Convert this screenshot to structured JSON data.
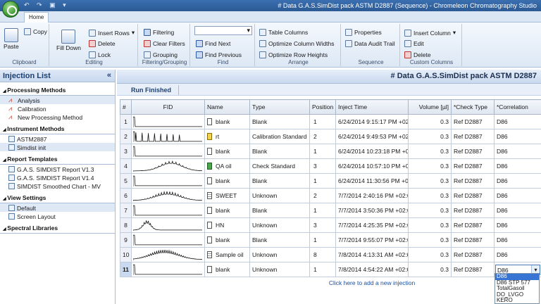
{
  "window": {
    "title": "# Data G.A.S.SimDist pack ASTM D2887 (Sequence) - Chromeleon Chromatography Studio"
  },
  "ribbon": {
    "tab": "Home",
    "clipboard": {
      "label": "Clipboard",
      "paste": "Paste",
      "copy": "Copy"
    },
    "editing": {
      "label": "Editing",
      "fill_down": "Fill Down",
      "insert_rows": "Insert Rows",
      "delete": "Delete",
      "lock": "Lock"
    },
    "filtering": {
      "label": "Filtering/Grouping",
      "filtering": "Filtering",
      "clear_filters": "Clear Filters",
      "grouping": "Grouping"
    },
    "find": {
      "label": "Find",
      "find_next": "Find Next",
      "find_previous": "Find Previous"
    },
    "arrange": {
      "label": "Arrange",
      "table_columns": "Table Columns",
      "optimize_widths": "Optimize Column Widths",
      "optimize_heights": "Optimize Row Heights"
    },
    "sequence": {
      "label": "Sequence",
      "properties": "Properties",
      "audit_trail": "Data Audit Trail"
    },
    "custom": {
      "label": "Custom Columns",
      "insert_column": "Insert Column",
      "edit": "Edit",
      "delete": "Delete"
    }
  },
  "sidebar": {
    "title": "Injection List",
    "collapse": "«",
    "sections": [
      {
        "title": "Processing Methods",
        "items": [
          "Analysis",
          "Calibration",
          "New Processing Method"
        ]
      },
      {
        "title": "Instrument Methods",
        "items": [
          "ASTM2887",
          "Simdist init"
        ]
      },
      {
        "title": "Report Templates",
        "items": [
          "G.A.S. SIMDIST Report V1.3",
          "G.A.S. SIMDIST Report V1.4",
          "SIMDIST Smoothed Chart - MV"
        ]
      },
      {
        "title": "View Settings",
        "items": [
          "Default",
          "Screen Layout"
        ]
      },
      {
        "title": "Spectral Libraries",
        "items": []
      }
    ]
  },
  "main": {
    "title": "# Data G.A.S.SimDist pack ASTM D2887",
    "run_tab": "Run Finished",
    "columns": [
      "#",
      "FID",
      "Name",
      "Type",
      "Position",
      "Inject Time",
      "Volume [µl]",
      "*Check Type",
      "*Correlation"
    ],
    "rows": [
      {
        "n": "1",
        "name": "blank",
        "type": "Blank",
        "pos": "1",
        "time": "6/24/2014 9:15:17 PM +02...",
        "vol": "0.3",
        "check": "Ref D2887",
        "corr": "D86",
        "fid": 0
      },
      {
        "n": "2",
        "name": "rt",
        "type": "Calibration Standard",
        "pos": "2",
        "time": "6/24/2014 9:49:53 PM +02...",
        "vol": "0.3",
        "check": "Ref D2887",
        "corr": "D86",
        "fid": 1
      },
      {
        "n": "3",
        "name": "blank",
        "type": "Blank",
        "pos": "1",
        "time": "6/24/2014 10:23:18 PM +02...",
        "vol": "0.3",
        "check": "Ref D2887",
        "corr": "D86",
        "fid": 0
      },
      {
        "n": "4",
        "name": "QA oil",
        "type": "Check Standard",
        "pos": "3",
        "time": "6/24/2014 10:57:10 PM +02...",
        "vol": "0.3",
        "check": "Ref D2887",
        "corr": "D86",
        "fid": 2
      },
      {
        "n": "5",
        "name": "blank",
        "type": "Blank",
        "pos": "1",
        "time": "6/24/2014 11:30:56 PM +02...",
        "vol": "0.3",
        "check": "Ref D2887",
        "corr": "D86",
        "fid": 0
      },
      {
        "n": "6",
        "name": "SWEET",
        "type": "Unknown",
        "pos": "2",
        "time": "7/7/2014 2:40:16 PM +02:00",
        "vol": "0.3",
        "check": "Ref D2887",
        "corr": "D86",
        "fid": 3
      },
      {
        "n": "7",
        "name": "blank",
        "type": "Blank",
        "pos": "1",
        "time": "7/7/2014 3:50:36 PM +02:00",
        "vol": "0.3",
        "check": "Ref D2887",
        "corr": "D86",
        "fid": 0
      },
      {
        "n": "8",
        "name": "HN",
        "type": "Unknown",
        "pos": "3",
        "time": "7/7/2014 4:25:35 PM +02:00",
        "vol": "0.3",
        "check": "Ref D2887",
        "corr": "D86",
        "fid": 4
      },
      {
        "n": "9",
        "name": "blank",
        "type": "Blank",
        "pos": "1",
        "time": "7/7/2014 9:55:07 PM +02:00",
        "vol": "0.3",
        "check": "Ref D2887",
        "corr": "D86",
        "fid": 0
      },
      {
        "n": "10",
        "name": "Sample oil",
        "type": "Unknown",
        "pos": "8",
        "time": "7/8/2014 4:13:31 AM +02:00",
        "vol": "0.3",
        "check": "Ref D2887",
        "corr": "D86",
        "fid": 5
      },
      {
        "n": "11",
        "name": "blank",
        "type": "Unknown",
        "pos": "1",
        "time": "7/8/2014 4:54:22 AM +02:00",
        "vol": "0.3",
        "check": "Ref D2887",
        "corr": "D86",
        "fid": 0
      }
    ],
    "add_row": "Click here to add a new injection",
    "dropdown_options": [
      "D86",
      "D86 STP 577",
      "TotalGasoil",
      "DO_LVGO",
      "KERO"
    ]
  }
}
